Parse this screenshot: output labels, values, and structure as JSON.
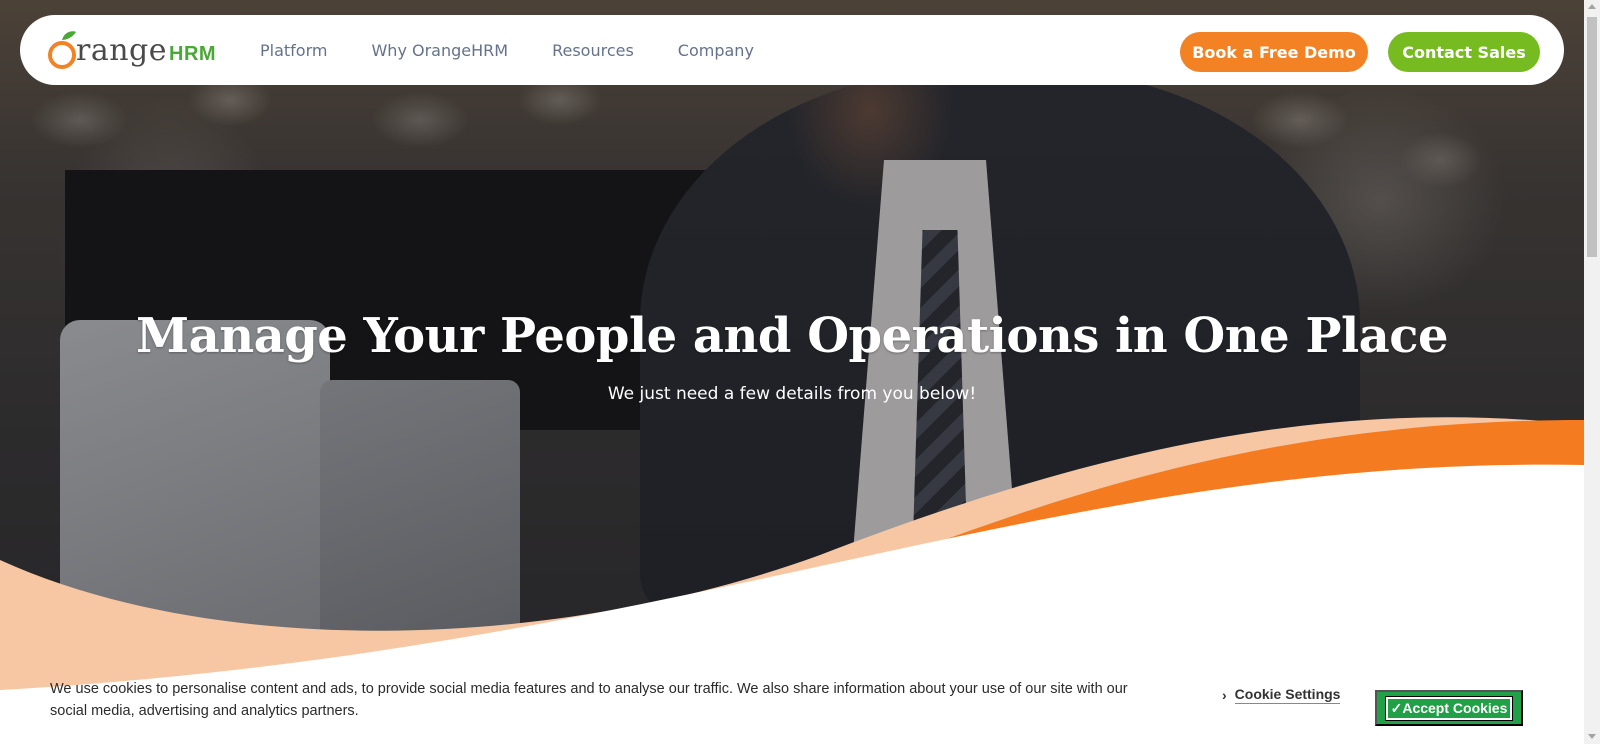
{
  "brand": {
    "logo_word": "range",
    "logo_initial": "O",
    "logo_suffix": "HRM",
    "orange": "#f28224",
    "green": "#76bc21",
    "nav_text": "#64728c"
  },
  "nav": {
    "links": [
      "Platform",
      "Why OrangeHRM",
      "Resources",
      "Company"
    ],
    "demo_label": "Book a Free Demo",
    "sales_label": "Contact Sales"
  },
  "hero": {
    "title": "Manage Your People and Operations in One Place",
    "subtitle": "We just need a few details from you below!"
  },
  "cookie": {
    "text": "We use cookies to personalise content and ads, to provide social media features and to analyse our traffic. We also share information about your use of our site with our social media, advertising and analytics partners.",
    "settings_label": "Cookie Settings",
    "accept_label": "✓Accept Cookies",
    "accept_color": "#21a147"
  },
  "icons": {
    "settings_chevron": "chevron-right-icon",
    "logo_leaf": "orange-leaf-icon"
  }
}
